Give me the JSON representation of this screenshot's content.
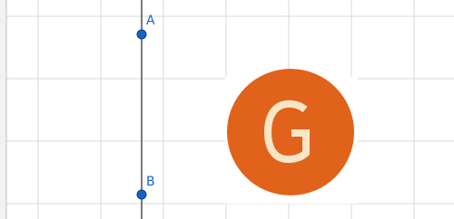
{
  "graphics_view": {
    "grid_visible": true,
    "colors": {
      "grid_line": "#d9d9d9",
      "left_border": "#bfbfbf",
      "axis_line": "#7a7a7a",
      "point_fill": "#1565c0",
      "point_stroke": "#0d3f8f",
      "label": "#1565c0"
    }
  },
  "points": [
    {
      "label": "A"
    },
    {
      "label": "B"
    }
  ],
  "logo": {
    "icon": "geogebra-g-logo-icon",
    "letter": "G",
    "circle_color": "#e1621a",
    "letter_color": "#f6e6c8"
  }
}
